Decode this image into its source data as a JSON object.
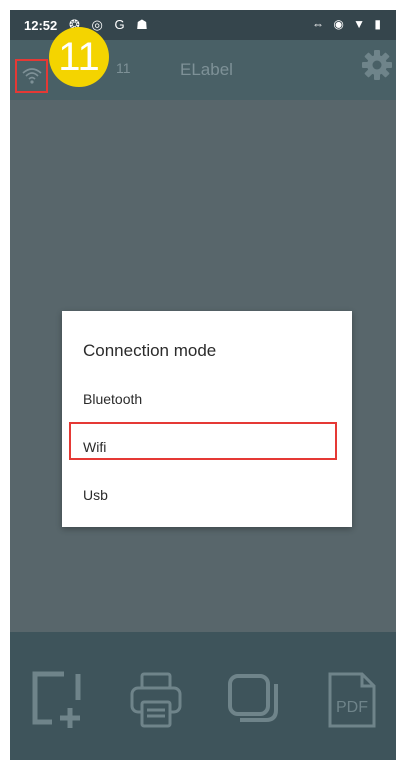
{
  "status_bar": {
    "time": "12:52",
    "left_icons": "❂ ◎ G ☗",
    "right_icons": "⇔ ◉ ▼ ▮"
  },
  "app_bar": {
    "title": "ELabel",
    "counter": "11",
    "wifi_icon": "wifi-icon",
    "settings_icon": "gear-icon"
  },
  "annotation": {
    "step_number": "11",
    "color": "#f4d400",
    "highlight_color": "#e53935"
  },
  "dialog": {
    "title": "Connection mode",
    "options": [
      "Bluetooth",
      "Wifi",
      "Usb"
    ],
    "selected": "Wifi"
  },
  "bottom_bar": {
    "buttons": [
      {
        "icon": "new-label-icon"
      },
      {
        "icon": "print-icon"
      },
      {
        "icon": "copy-icon"
      },
      {
        "icon": "pdf-icon",
        "label": "PDF"
      }
    ]
  },
  "colors": {
    "status_bar": "#35454c",
    "app_bar": "#496066",
    "scrim": "#58666b",
    "bottom_bar": "#3e545b",
    "icon": "#6f848a"
  }
}
